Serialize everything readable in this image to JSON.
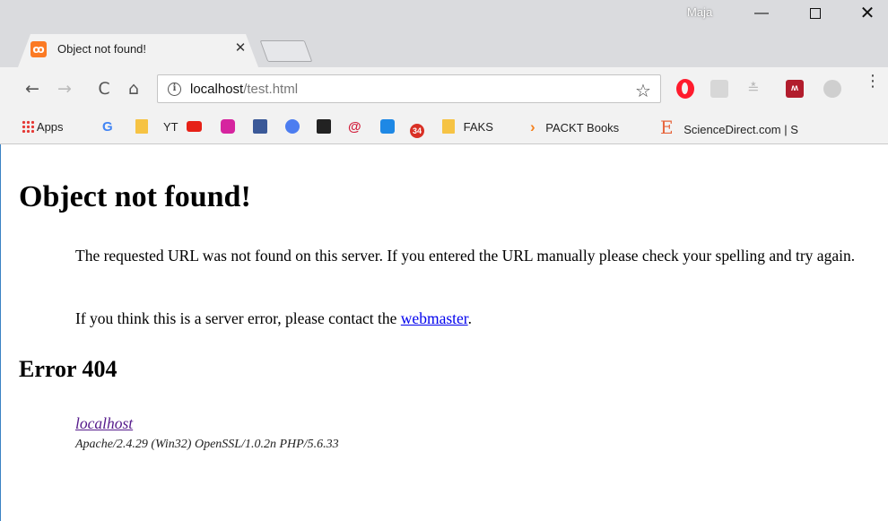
{
  "window": {
    "profile_name": "Maja",
    "minimize_glyph": "—",
    "close_glyph": "✕"
  },
  "tab": {
    "favicon_text": "ꝏ",
    "title": "Object not found!",
    "close_glyph": "✕"
  },
  "toolbar": {
    "back_glyph": "←",
    "forward_glyph": "→",
    "reload_glyph": "C",
    "home_glyph": "⌂",
    "info_glyph": "i",
    "url_host": "localhost",
    "url_path": "/test.html",
    "star_glyph": "☆",
    "menu_glyph": "⋮",
    "extensions": [
      "opera-icon",
      "pdf-icon",
      "download-icon",
      "mendeley-icon",
      "profile-circle-icon"
    ],
    "ext_m_text": "ʍ",
    "ext_dl_text": "≛"
  },
  "bookmarks": {
    "items": [
      {
        "label": "Apps",
        "icon": "apps-icon"
      },
      {
        "label": "",
        "icon": "google-icon",
        "glyph": "G"
      },
      {
        "label": "",
        "icon": "folder-icon"
      },
      {
        "label": "YT",
        "icon": "youtube-label"
      },
      {
        "label": "",
        "icon": "youtube-icon"
      },
      {
        "label": "",
        "icon": "instagram-icon"
      },
      {
        "label": "",
        "icon": "facebook-icon"
      },
      {
        "label": "",
        "icon": "circle-icon"
      },
      {
        "label": "",
        "icon": "shopping-bag-icon"
      },
      {
        "label": "",
        "icon": "at-icon",
        "glyph": "@"
      },
      {
        "label": "",
        "icon": "p-icon"
      },
      {
        "label": "",
        "icon": "badge-34-icon",
        "glyph": "34"
      },
      {
        "label": "FAKS",
        "icon": "folder-icon"
      },
      {
        "label": "PACKT Books",
        "icon": "packt-icon",
        "glyph": "›"
      },
      {
        "label": "ScienceDirect.com | S",
        "icon": "elsevier-icon",
        "glyph": "E"
      }
    ]
  },
  "page": {
    "heading": "Object not found!",
    "paragraph1": "The requested URL was not found on this server. If you entered the URL manually please check your spelling and try again.",
    "paragraph2_prefix": "If you think this is a server error, please contact the ",
    "paragraph2_link": "webmaster",
    "paragraph2_suffix": ".",
    "error_heading": "Error 404",
    "address_link": "localhost",
    "server_signature": "Apache/2.4.29 (Win32) OpenSSL/1.0.2n PHP/5.6.33"
  }
}
